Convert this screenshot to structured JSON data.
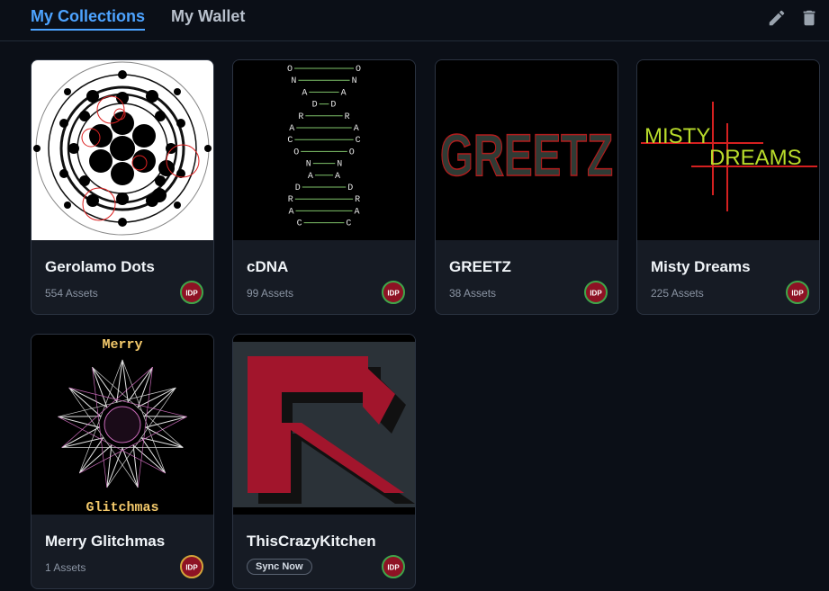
{
  "tabs": {
    "collections": "My Collections",
    "wallet": "My Wallet"
  },
  "toolbar": {
    "edit_icon": "pencil-icon",
    "delete_icon": "trash-icon"
  },
  "badge_label": "IDP",
  "collections": [
    {
      "title": "Gerolamo Dots",
      "assets": "554 Assets"
    },
    {
      "title": "cDNA",
      "assets": "99 Assets",
      "dna": [
        "O",
        "O",
        "N",
        "N",
        "A",
        "A",
        "D",
        "D",
        "R",
        "R",
        "A",
        "A",
        "C",
        "C",
        "O",
        "O",
        "N",
        "N",
        "A",
        "A",
        "D",
        "D",
        "R",
        "R",
        "A",
        "A",
        "C",
        "C"
      ]
    },
    {
      "title": "GREETZ",
      "assets": "38 Assets",
      "art_text": "GREETZ"
    },
    {
      "title": "Misty Dreams",
      "assets": "225 Assets",
      "art_line1": "MISTY",
      "art_line2": "DREAMS"
    },
    {
      "title": "Merry Glitchmas",
      "assets": "1 Assets",
      "art_top": "Merry",
      "art_bottom": "Glitchmas"
    },
    {
      "title": "ThisCrazyKitchen",
      "sync_label": "Sync Now"
    }
  ],
  "colors": {
    "accent": "#4da3ff",
    "background": "#0b0f17",
    "card": "#161b24",
    "badge_red": "#8e1224",
    "badge_ring": "#3fa64a"
  }
}
